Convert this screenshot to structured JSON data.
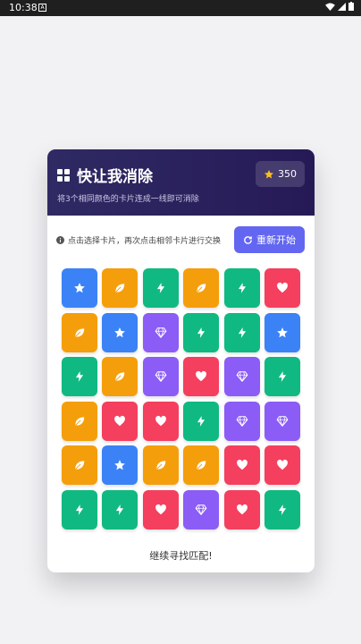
{
  "status_bar": {
    "time": "10:38",
    "notification": "A"
  },
  "game": {
    "title": "快让我消除",
    "subtitle": "将3个相同颜色的卡片连成一线即可消除",
    "score": "350",
    "hint": "点击选择卡片，再次点击相邻卡片进行交换",
    "restart_label": "重新开始",
    "status": "继续寻找匹配!"
  },
  "colors": {
    "blue": "#3b82f6",
    "orange": "#f59e0b",
    "green": "#10b981",
    "red": "#f43f5e",
    "purple": "#8b5cf6",
    "accent": "#6366f1",
    "header": "#2a2160"
  },
  "board": [
    [
      "star",
      "leaf",
      "bolt",
      "leaf",
      "bolt",
      "heart"
    ],
    [
      "leaf",
      "star",
      "gem",
      "bolt",
      "bolt",
      "star"
    ],
    [
      "bolt",
      "leaf",
      "gem",
      "heart",
      "gem",
      "bolt"
    ],
    [
      "leaf",
      "heart",
      "heart",
      "bolt",
      "gem",
      "gem"
    ],
    [
      "leaf",
      "star",
      "leaf",
      "leaf",
      "heart",
      "heart"
    ],
    [
      "bolt",
      "bolt",
      "heart",
      "gem",
      "heart",
      "bolt"
    ]
  ],
  "tile_types": {
    "star": "blue",
    "leaf": "orange",
    "bolt": "green",
    "heart": "red",
    "gem": "purple"
  }
}
